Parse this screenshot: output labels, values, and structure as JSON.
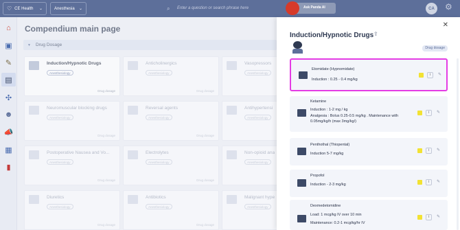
{
  "topbar": {
    "brand": "CE Health",
    "department": "Anesthesia",
    "search_placeholder": "Enter a question or search phrase here",
    "ask_label": "Ask Panda AI",
    "user_initials": "CA"
  },
  "page": {
    "title": "Compendium main page",
    "section_label": "Drug Dosage"
  },
  "cards": [
    {
      "title": "Induction/Hypnotic Drugs",
      "badge": "Anesthesiology",
      "footer": "Drug dosage"
    },
    {
      "title": "Anticholinergics",
      "badge": "Anesthesiology",
      "footer": "Drug dosage"
    },
    {
      "title": "Vasopressors",
      "badge": "Anesthesiology",
      "footer": "Drug dosage"
    },
    {
      "title": "Neuromuscular blocking drugs",
      "badge": "Anesthesiology",
      "footer": "Drug dosage"
    },
    {
      "title": "Reversal agents",
      "badge": "Anesthesiology",
      "footer": "Drug dosage"
    },
    {
      "title": "Antihypertensi",
      "badge": "Anesthesiology",
      "footer": "Drug dosage"
    },
    {
      "title": "Postoperative Nausea and Vo...",
      "badge": "Anesthesiology",
      "footer": "Drug dosage"
    },
    {
      "title": "Electrolytes",
      "badge": "Anesthesiology",
      "footer": "Drug dosage"
    },
    {
      "title": "Non-opioid ana",
      "badge": "Anesthesiology",
      "footer": "Drug dosage"
    },
    {
      "title": "Diuretics",
      "badge": "Anesthesiology",
      "footer": "Drug dosage"
    },
    {
      "title": "Antibiotics",
      "badge": "Anesthesiology",
      "footer": "Drug dosage"
    },
    {
      "title": "Malignant hype",
      "badge": "Anesthesiology",
      "footer": "Drug dosage"
    }
  ],
  "panel": {
    "title": "Induction/Hypnotic Drugs",
    "tag": "Drug dosage",
    "drugs": [
      {
        "name": "Etomidate (Hypnomidate)",
        "lines": [
          "Induction : 0.25 - 0.4 mg/kg"
        ]
      },
      {
        "name": "Ketamine",
        "lines": [
          "Induction : 1-2 mg / kg",
          "Analgesia : Bolus 0.25-0.5 mg/kg . Maintenance with 0.05mg/kg/h (max 3mg/kg/)"
        ]
      },
      {
        "name": "Penthothal (Thiopental)",
        "lines": [
          "Induction 5-7 mg/kg"
        ]
      },
      {
        "name": "Propofol",
        "lines": [
          "Induction - 2-3 mg/kg"
        ]
      },
      {
        "name": "Dexmedetomidine",
        "lines": [
          "Load: 1 mcg/kg IV over 10 min",
          "Maintenance: 0.2-1 mcg/kg/hr IV"
        ]
      }
    ],
    "info_glyph": "i"
  },
  "colors": {
    "topbar": "#5d6f9a",
    "highlight": "#e43be4",
    "marker": "#f2e233"
  }
}
